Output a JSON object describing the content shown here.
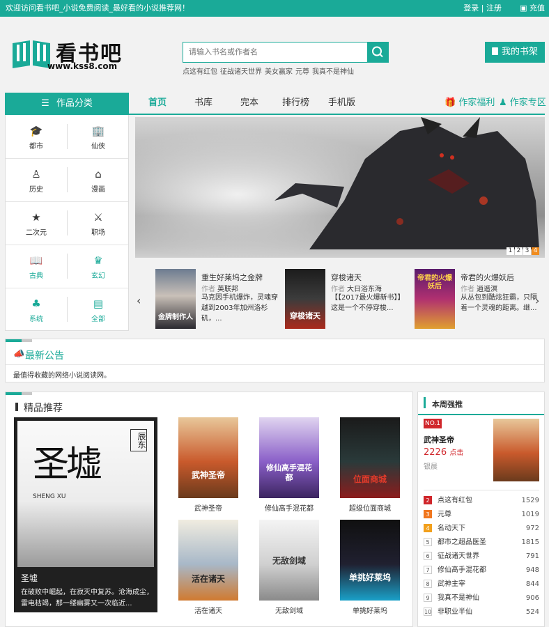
{
  "topbar": {
    "welcome": "欢迎访问看书吧_小说免费阅读_最好看的小说推荐网！",
    "login": "登录",
    "register": "注册",
    "recharge": "充值"
  },
  "logo": {
    "title": "看书吧",
    "url": "www.kss8.com"
  },
  "search": {
    "placeholder": "请输入书名或作者名",
    "hot": [
      "点这有红包",
      "征战诸天世界",
      "美女赢家",
      "元尊",
      "我真不是神仙"
    ]
  },
  "shelf_label": "我的书架",
  "category_title": "作品分类",
  "nav": {
    "items": [
      "首页",
      "书库",
      "完本",
      "排行榜",
      "手机版"
    ],
    "welfare": "作家福利",
    "author_zone": "作家专区"
  },
  "categories": [
    "都市",
    "仙侠",
    "历史",
    "漫画",
    "二次元",
    "职场",
    "古典",
    "玄幻",
    "系统",
    "全部"
  ],
  "banner": {
    "pages": [
      "1",
      "2",
      "3",
      "4"
    ],
    "active_page": "4"
  },
  "featured": [
    {
      "title": "重生好莱坞之金牌",
      "author_label": "作者",
      "author": "英联邦",
      "desc": "马克因手机爆炸，灵魂穿越到2003年加州洛杉矶，...",
      "cover_text": "金牌制作人",
      "colors": [
        "#6d7c90",
        "#c9c0b8",
        "#2b2a30"
      ]
    },
    {
      "title": "穿梭诸天",
      "author_label": "作者",
      "author": "大日浴东海",
      "desc": "【【2017最火爆新书】】这是一个不停穿梭...",
      "cover_text": "穿梭诸天",
      "colors": [
        "#1c1c1c",
        "#3c3c3c",
        "#aa2a1c"
      ]
    },
    {
      "title": "帝君的火爆妖后",
      "author_label": "作者",
      "author": "逍遥溟",
      "desc": "从丛包到酷炫狂霸，只隔着一个灵魂的距离。继...",
      "cover_text": "帝君的火爆妖后",
      "colors": [
        "#5a1c6c",
        "#b03070",
        "#e0a030"
      ]
    }
  ],
  "notice": {
    "title": "最新公告",
    "text": "最值得收藏的网络小说阅读网。"
  },
  "recommend": {
    "title": "精品推荐",
    "big": {
      "title": "圣墟",
      "desc": "在破败中崛起，在寂灭中复苏。沧海成尘，雷电枯竭，那一缕幽雾又一次临近...",
      "cover_text": "圣墟",
      "cover_subtext": "SHENG XU",
      "author_seal": "辰东"
    },
    "books": [
      {
        "name": "武神圣帝",
        "cover_text": "武神圣帝",
        "colors": [
          "#e8c79a",
          "#c95a2c",
          "#6a3a1c"
        ]
      },
      {
        "name": "修仙高手混花都",
        "cover_text": "修仙高手混花都",
        "colors": [
          "#e0d4f0",
          "#8a5fc8",
          "#3c2560"
        ]
      },
      {
        "name": "超级位面商城",
        "cover_text": "位面商城",
        "colors": [
          "#1a1a1a",
          "#2a3a3a",
          "#8c1c1c"
        ]
      },
      {
        "name": "活在诸天",
        "cover_text": "活在诸天",
        "colors": [
          "#f0ece0",
          "#a8b8c8",
          "#d07a30"
        ]
      },
      {
        "name": "无敌剑域",
        "cover_text": "无敌剑域",
        "colors": [
          "#f4f4f4",
          "#d0d0d0",
          "#8a8a8a"
        ]
      },
      {
        "name": "单挑好莱坞",
        "cover_text": "单挑好莱坞",
        "colors": [
          "#101010",
          "#202030",
          "#1aa0c8"
        ]
      }
    ]
  },
  "weekly": {
    "title": "本周强推",
    "top": {
      "badge": "NO.1",
      "title": "武神圣帝",
      "count": "2226",
      "count_unit": "点击",
      "author": "银晨"
    },
    "list": [
      {
        "rank": "2",
        "name": "点这有红包",
        "count": "1529"
      },
      {
        "rank": "3",
        "name": "元尊",
        "count": "1019"
      },
      {
        "rank": "4",
        "name": "名动天下",
        "count": "972"
      },
      {
        "rank": "5",
        "name": "都市之超品医圣",
        "count": "1815"
      },
      {
        "rank": "6",
        "name": "征战诸天世界",
        "count": "791"
      },
      {
        "rank": "7",
        "name": "修仙高手混花都",
        "count": "948"
      },
      {
        "rank": "8",
        "name": "武神主宰",
        "count": "844"
      },
      {
        "rank": "9",
        "name": "我真不是神仙",
        "count": "906"
      },
      {
        "rank": "10",
        "name": "非职业半仙",
        "count": "524"
      }
    ]
  },
  "colors": {
    "accent": "#1aaa98",
    "rank_red": "#d0262b",
    "rank_orange": "#f0761e",
    "pager_active": "#f08c1f"
  }
}
